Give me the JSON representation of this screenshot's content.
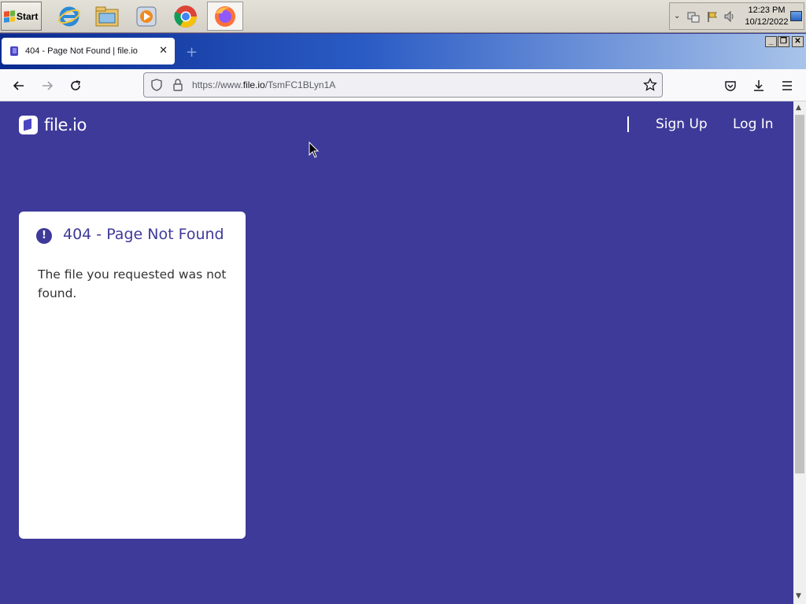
{
  "taskbar": {
    "start_label": "Start",
    "pinned": [
      {
        "name": "internet-explorer-icon"
      },
      {
        "name": "file-explorer-icon"
      },
      {
        "name": "media-player-icon"
      },
      {
        "name": "chrome-icon"
      },
      {
        "name": "firefox-icon",
        "active": true
      }
    ],
    "clock": {
      "time": "12:23 PM",
      "date": "10/12/2022"
    }
  },
  "browser": {
    "tab": {
      "title": "404 - Page Not Found | file.io"
    },
    "new_tab_glyph": "+",
    "url": {
      "prefix": "https://www.",
      "host": "file.io",
      "path": "/TsmFC1BLyn1A"
    },
    "window_controls": [
      "_",
      "❐",
      "✕"
    ]
  },
  "site": {
    "logo_text": "file.io",
    "nav": {
      "signup": "Sign Up",
      "login": "Log In"
    },
    "error_card": {
      "icon_glyph": "!",
      "title": "404 - Page Not Found",
      "message": "The file you requested was not found."
    }
  },
  "colors": {
    "page_bg": "#3e3a9a",
    "card_bg": "#ffffff",
    "accent": "#3e3a9a"
  }
}
